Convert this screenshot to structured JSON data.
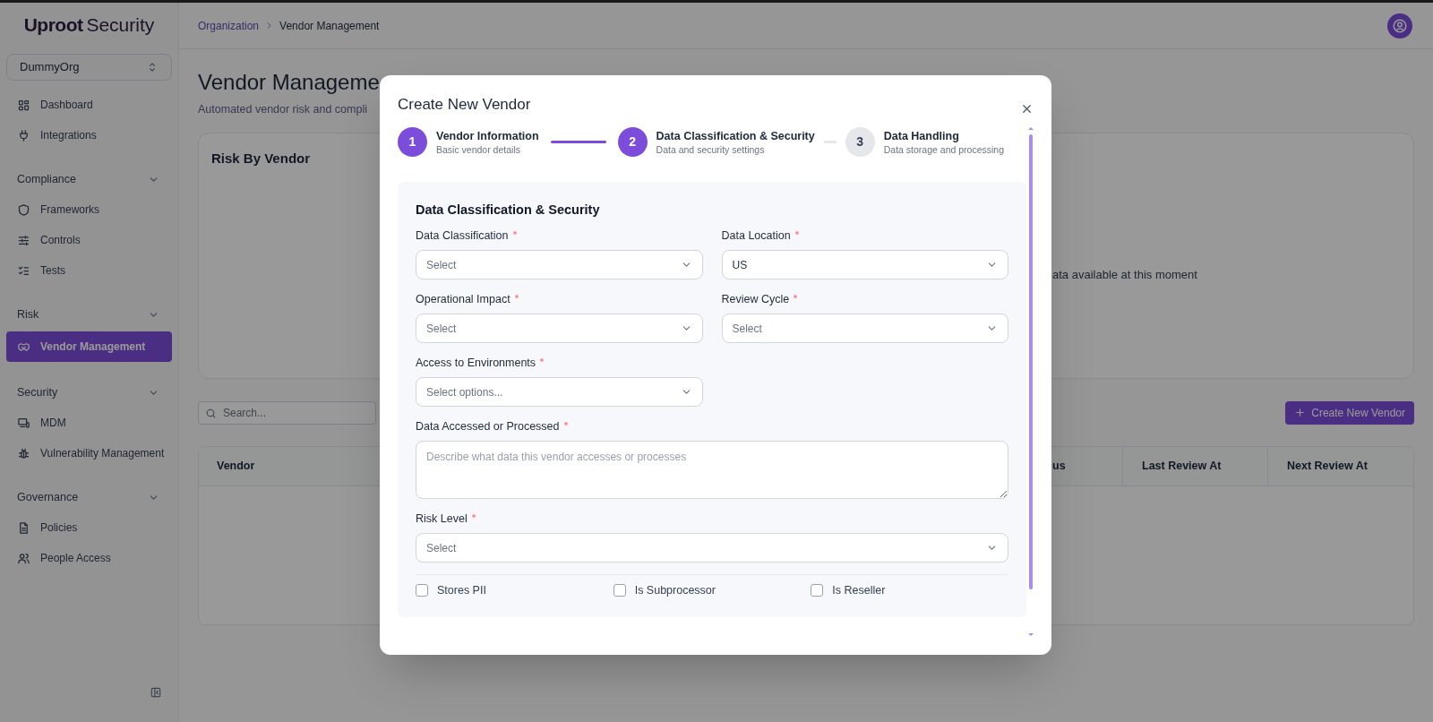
{
  "sidebar": {
    "logo": {
      "brand": "Uproot",
      "suffix": "Security"
    },
    "org_selector": "DummyOrg",
    "items": [
      {
        "kind": "link",
        "label": "Dashboard",
        "selected": false
      },
      {
        "kind": "link",
        "label": "Integrations",
        "selected": false
      },
      {
        "kind": "section",
        "label": "Compliance",
        "expanded": true
      },
      {
        "kind": "link",
        "label": "Frameworks",
        "selected": false
      },
      {
        "kind": "link",
        "label": "Controls",
        "selected": false
      },
      {
        "kind": "link",
        "label": "Tests",
        "selected": false
      },
      {
        "kind": "section",
        "label": "Risk",
        "expanded": true
      },
      {
        "kind": "link",
        "label": "Vendor Management",
        "selected": true
      },
      {
        "kind": "section",
        "label": "Security",
        "expanded": true
      },
      {
        "kind": "link",
        "label": "MDM",
        "selected": false
      },
      {
        "kind": "link",
        "label": "Vulnerability Management",
        "selected": false
      },
      {
        "kind": "section",
        "label": "Governance",
        "expanded": true
      },
      {
        "kind": "link",
        "label": "Policies",
        "selected": false
      },
      {
        "kind": "link",
        "label": "People Access",
        "selected": false
      }
    ]
  },
  "header": {
    "breadcrumb": [
      "Organization",
      "Vendor Management"
    ]
  },
  "page": {
    "title": "Vendor Manageme",
    "subtitle": "Automated vendor risk and compli",
    "risk_card": {
      "title": "Risk By Vendor",
      "empty_message": "ata available at this moment"
    },
    "search": {
      "placeholder": "Search..."
    },
    "create_button": "Create New Vendor",
    "table": {
      "columns": [
        "Vendor",
        "us",
        "Last Review At",
        "Next Review At"
      ]
    }
  },
  "modal": {
    "title": "Create New Vendor",
    "steps": [
      {
        "number": "1",
        "title": "Vendor Information",
        "subtitle": "Basic vendor details",
        "active": true
      },
      {
        "number": "2",
        "title": "Data Classification & Security",
        "subtitle": "Data and security settings",
        "active": true
      },
      {
        "number": "3",
        "title": "Data Handling",
        "subtitle": "Data storage and processing",
        "active": false
      }
    ],
    "form": {
      "heading": "Data Classification & Security",
      "fields": [
        {
          "kind": "select",
          "label": "Data Classification",
          "required": true,
          "placeholder": "Select",
          "full_width": false
        },
        {
          "kind": "select",
          "label": "Data Location",
          "required": true,
          "value": "US",
          "full_width": false
        },
        {
          "kind": "select",
          "label": "Operational Impact",
          "required": true,
          "placeholder": "Select",
          "full_width": false
        },
        {
          "kind": "select",
          "label": "Review Cycle",
          "required": true,
          "placeholder": "Select",
          "full_width": false
        },
        {
          "kind": "select",
          "label": "Access to Environments",
          "required": true,
          "placeholder": "Select options...",
          "full_width": false
        },
        {
          "kind": "textarea",
          "label": "Data Accessed or Processed",
          "required": true,
          "placeholder": "Describe what data this vendor accesses or processes",
          "full_width": true
        },
        {
          "kind": "select",
          "label": "Risk Level",
          "required": true,
          "placeholder": "Select",
          "full_width": true
        }
      ],
      "checkboxes": [
        {
          "label": "Stores PII",
          "checked": false
        },
        {
          "label": "Is Subprocessor",
          "checked": false
        },
        {
          "label": "Is Reseller",
          "checked": false
        }
      ]
    }
  }
}
